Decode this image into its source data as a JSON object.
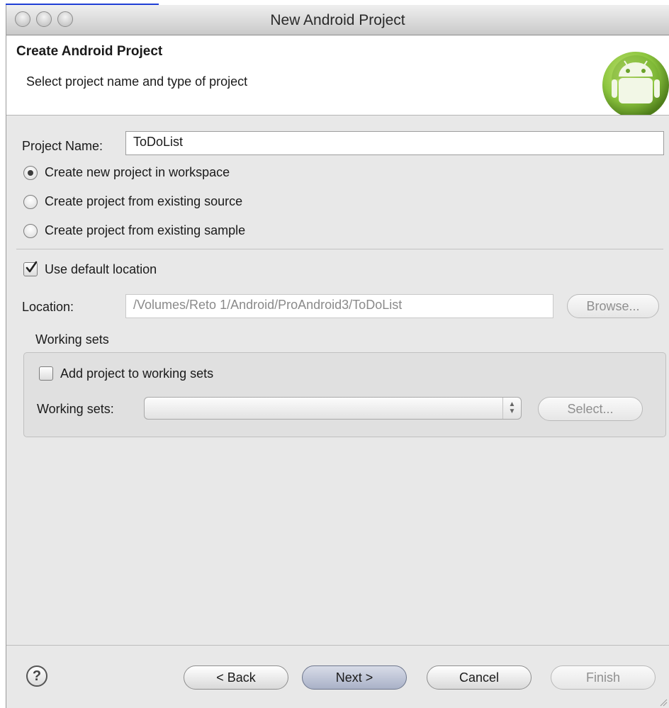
{
  "window": {
    "title": "New Android Project"
  },
  "header": {
    "title": "Create Android Project",
    "subtitle": "Select project name and type of project",
    "logo_icon": "android-logo-icon"
  },
  "project": {
    "name_label": "Project Name:",
    "name_value": "ToDoList",
    "options": [
      {
        "label": "Create new project in workspace",
        "selected": true
      },
      {
        "label": "Create project from existing source",
        "selected": false
      },
      {
        "label": "Create project from existing sample",
        "selected": false
      }
    ]
  },
  "location": {
    "use_default_label": "Use default location",
    "use_default_checked": true,
    "label": "Location:",
    "value": "/Volumes/Reto 1/Android/ProAndroid3/ToDoList",
    "browse_label": "Browse..."
  },
  "working_sets": {
    "group_title": "Working sets",
    "add_label": "Add project to working sets",
    "add_checked": false,
    "sets_label": "Working sets:",
    "sets_value": "",
    "select_label": "Select..."
  },
  "footer": {
    "back_label": "< Back",
    "next_label": "Next >",
    "cancel_label": "Cancel",
    "finish_label": "Finish"
  },
  "colors": {
    "link_underline": "#1f3fd6",
    "android_green": "#8dc63f",
    "window_bg": "#e8e8e8"
  }
}
